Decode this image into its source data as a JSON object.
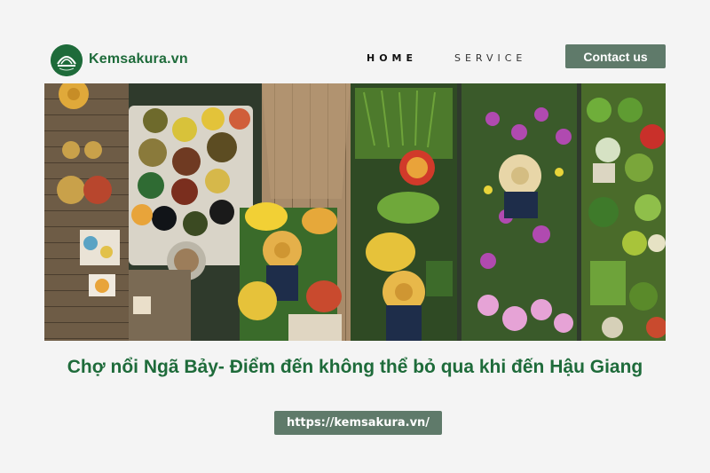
{
  "brand": {
    "name": "Kemsakura.vn",
    "logo_icon": "leaf-logo-icon"
  },
  "nav": {
    "home": "HOME",
    "service": "SERVICE",
    "contact": "Contact us"
  },
  "hero": {
    "image": "floating-market-aerial-photo"
  },
  "article": {
    "title": "Chợ nổi Ngã Bảy- Điểm đến không thể bỏ qua khi đến Hậu Giang"
  },
  "footer": {
    "url": "https://kemsakura.vn/"
  },
  "colors": {
    "brand_green": "#1e6b3a",
    "button_green": "#5f7a6a",
    "background": "#f4f4f4"
  }
}
